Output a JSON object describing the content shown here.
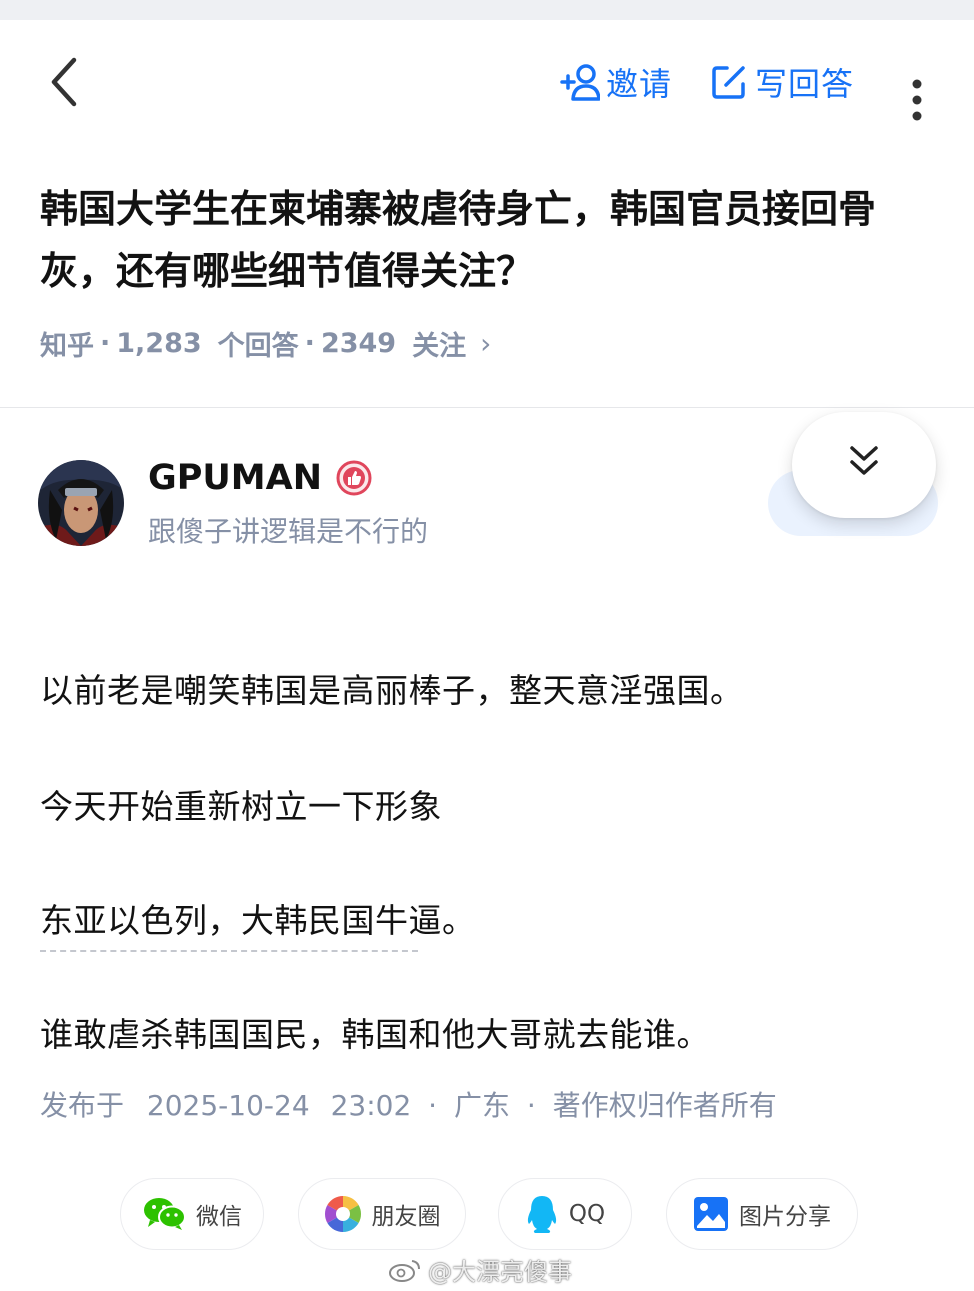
{
  "colors": {
    "accent": "#1772f6",
    "meta_gray": "#8590a6",
    "text": "#121212"
  },
  "topbar": {
    "back_icon": "chevron-left-icon",
    "invite_label": "邀请",
    "write_answer_label": "写回答",
    "more_icon": "more-vertical-icon"
  },
  "question": {
    "title": "韩国大学生在柬埔寨被虐待身亡，韩国官员接回骨灰，还有哪些细节值得关注？",
    "source": "知乎",
    "answers_count": "1,283",
    "answers_label": "个回答",
    "followers_count": "2349",
    "followers_label": "关注",
    "chevron": "›"
  },
  "author": {
    "name": "GPUMAN",
    "bio": "跟傻子讲逻辑是不行的"
  },
  "answer": {
    "paragraphs": [
      "以前老是嘲笑韩国是高丽棒子，整天意淫强国。",
      "今天开始重新树立一下形象",
      "东亚以色列，大韩民国牛逼。",
      "谁敢虐杀韩国国民，韩国和他大哥就去能谁。"
    ],
    "published_prefix": "发布于",
    "published_date": "2025-10-24",
    "published_time": "23:02",
    "location": "广东",
    "copyright": "著作权归作者所有"
  },
  "share": {
    "wechat": "微信",
    "moments": "朋友圈",
    "qq": "QQ",
    "image": "图片分享"
  },
  "watermark": "@大漂亮傻事"
}
